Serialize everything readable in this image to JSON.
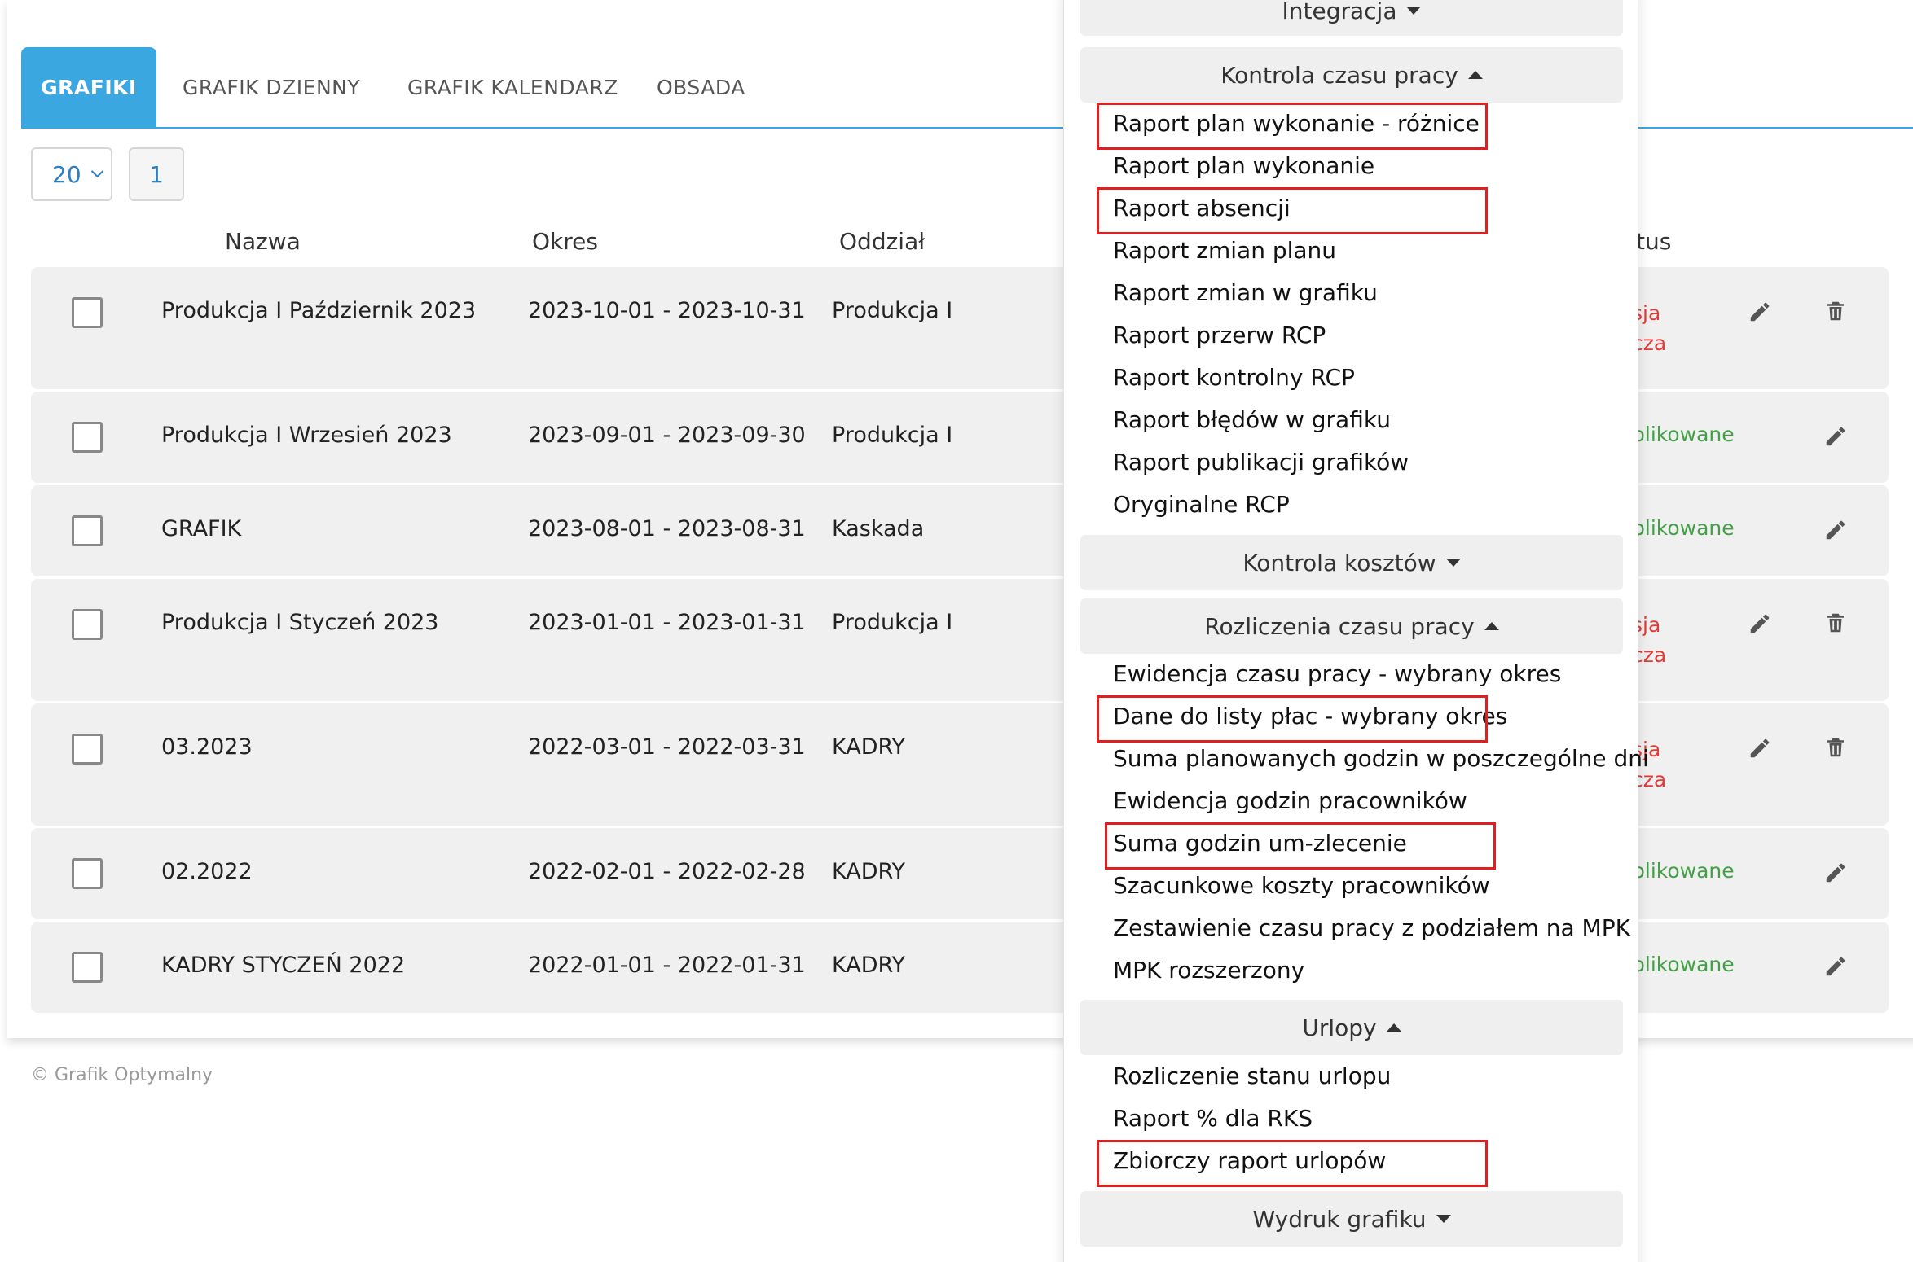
{
  "tabs": [
    {
      "label": "GRAFIKI",
      "active": true
    },
    {
      "label": "GRAFIK DZIENNY",
      "active": false
    },
    {
      "label": "GRAFIK KALENDARZ",
      "active": false
    },
    {
      "label": "OBSADA",
      "active": false
    }
  ],
  "pagination": {
    "page_size": "20",
    "page": "1"
  },
  "table": {
    "headers": {
      "name": "Nazwa",
      "period": "Okres",
      "department": "Oddział",
      "status": "tus"
    },
    "rows": [
      {
        "name": "Produkcja I Październik 2023",
        "period": "2023-10-01 - 2023-10-31",
        "department": "Produkcja I",
        "status_line1": "sja",
        "status_line2": "cza",
        "status_color": "#e53935"
      },
      {
        "name": "Produkcja I Wrzesień 2023",
        "period": "2023-09-01 - 2023-09-30",
        "department": "Produkcja I",
        "status_line1": "blikowane",
        "status_color": "#43a047"
      },
      {
        "name": "GRAFIK",
        "period": "2023-08-01 - 2023-08-31",
        "department": "Kaskada",
        "status_line1": "blikowane",
        "status_color": "#43a047"
      },
      {
        "name": "Produkcja I Styczeń 2023",
        "period": "2023-01-01 - 2023-01-31",
        "department": "Produkcja I",
        "status_line1": "sja",
        "status_line2": "cza",
        "status_color": "#e53935"
      },
      {
        "name": "03.2023",
        "period": "2022-03-01 - 2022-03-31",
        "department": "KADRY",
        "status_line1": "sja",
        "status_line2": "cza",
        "status_color": "#e53935"
      },
      {
        "name": "02.2022",
        "period": "2022-02-01 - 2022-02-28",
        "department": "KADRY",
        "status_line1": "blikowane",
        "status_color": "#43a047"
      },
      {
        "name": "KADRY STYCZEŃ 2022",
        "period": "2022-01-01 - 2022-01-31",
        "department": "KADRY",
        "status_line1": "blikowane",
        "status_color": "#43a047"
      }
    ]
  },
  "footer": "© Grafik Optymalny",
  "menu": {
    "integracja": "Integracja",
    "kontrola_czasu": {
      "title": "Kontrola czasu pracy",
      "items": [
        "Raport plan wykonanie - różnice",
        "Raport plan wykonanie",
        "Raport absencji",
        "Raport zmian planu",
        "Raport zmian w grafiku",
        "Raport przerw RCP",
        "Raport kontrolny RCP",
        "Raport błędów w grafiku",
        "Raport publikacji grafików",
        "Oryginalne RCP"
      ]
    },
    "kontrola_kosztow": "Kontrola kosztów",
    "rozliczenia": {
      "title": "Rozliczenia czasu pracy",
      "items": [
        "Ewidencja czasu pracy - wybrany okres",
        "Dane do listy płac - wybrany okres",
        "Suma planowanych godzin w poszczególne dni",
        "Ewidencja godzin pracowników",
        "Suma godzin um-zlecenie",
        "Szacunkowe koszty pracowników",
        "Zestawienie czasu pracy z podziałem na MPK",
        "MPK rozszerzony"
      ]
    },
    "urlopy": {
      "title": "Urlopy",
      "items": [
        "Rozliczenie stanu urlopu",
        "Raport % dla RKS",
        "Zbiorczy raport urlopów"
      ]
    },
    "wydruk": "Wydruk grafiku"
  },
  "colors": {
    "accent": "#3aa7e0",
    "highlight": "#e02020",
    "status_red": "#e53935",
    "status_green": "#43a047"
  }
}
